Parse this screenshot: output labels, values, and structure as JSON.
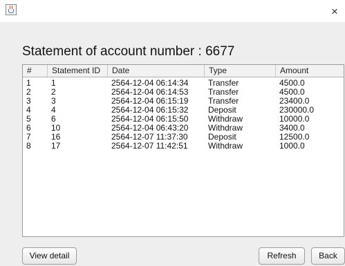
{
  "window": {
    "close_glyph": "×",
    "icon": "java-app-icon"
  },
  "heading": "Statement of account number : 6677",
  "table": {
    "columns": [
      "#",
      "Statement ID",
      "Date",
      "Type",
      "Amount"
    ],
    "rows": [
      [
        "1",
        "1",
        "2564-12-04 06:14:34",
        "Transfer",
        "4500.0"
      ],
      [
        "2",
        "2",
        "2564-12-04 06:14:53",
        "Transfer",
        "4500.0"
      ],
      [
        "3",
        "3",
        "2564-12-04 06:15:19",
        "Transfer",
        "23400.0"
      ],
      [
        "4",
        "4",
        "2564-12-04 06:15:32",
        "Deposit",
        "230000.0"
      ],
      [
        "5",
        "6",
        "2564-12-04 06:15:50",
        "Withdraw",
        "10000.0"
      ],
      [
        "6",
        "10",
        "2564-12-04 06:43:20",
        "Withdraw",
        "3400.0"
      ],
      [
        "7",
        "16",
        "2564-12-07 11:37:30",
        "Deposit",
        "12500.0"
      ],
      [
        "8",
        "17",
        "2564-12-07 11:42:51",
        "Withdraw",
        "1000.0"
      ]
    ]
  },
  "buttons": {
    "view_detail": "View detail",
    "refresh": "Refresh",
    "back": "Back"
  }
}
